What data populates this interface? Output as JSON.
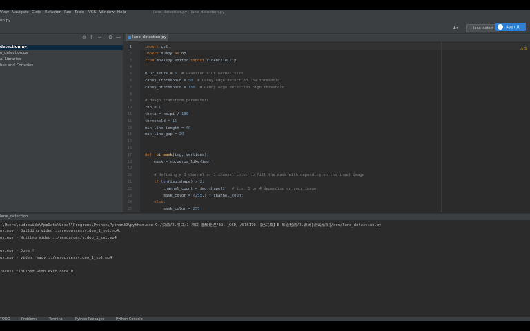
{
  "window": {
    "title": "lane_detection.py - lane_detection.py"
  },
  "menu": [
    "View",
    "Navigate",
    "Code",
    "Refactor",
    "Run",
    "Tools",
    "VCS",
    "Window",
    "Help"
  ],
  "breadcrumb": "on.py",
  "toolbar": {
    "run_config": "lane_detect",
    "ext_button": "实用工具"
  },
  "project": {
    "items": [
      "detection.py",
      "e_detection.py",
      "al Libraries",
      "hes and Consoles"
    ]
  },
  "editor": {
    "tab": "lane_detection.py",
    "warning": "⚠ 5",
    "lines": [
      {
        "n": "1",
        "t": [
          [
            "kw",
            "import "
          ],
          [
            "",
            "cv2"
          ]
        ]
      },
      {
        "n": "2",
        "t": [
          [
            "kw",
            "import "
          ],
          [
            "",
            "numpy "
          ],
          [
            "kw",
            "as "
          ],
          [
            "",
            "np"
          ]
        ]
      },
      {
        "n": "3",
        "t": [
          [
            "kw",
            "from "
          ],
          [
            "",
            "moviepy.editor "
          ],
          [
            "kw",
            "import "
          ],
          [
            "",
            "VideoFileClip"
          ]
        ]
      },
      {
        "n": "4",
        "t": []
      },
      {
        "n": "5",
        "t": [
          [
            "",
            "blur_ksize = "
          ],
          [
            "num",
            "5"
          ],
          [
            "cm",
            "  # Gaussian blur kernel size"
          ]
        ]
      },
      {
        "n": "6",
        "t": [
          [
            "",
            "canny_lthreshold = "
          ],
          [
            "num",
            "50"
          ],
          [
            "cm",
            "  # Canny edge detection low threshold"
          ]
        ]
      },
      {
        "n": "7",
        "t": [
          [
            "",
            "canny_hthreshold = "
          ],
          [
            "num",
            "150"
          ],
          [
            "cm",
            "  # Canny edge detection high threshold"
          ]
        ]
      },
      {
        "n": "8",
        "t": []
      },
      {
        "n": "9",
        "t": [
          [
            "cm",
            "# Hough transform parameters"
          ]
        ]
      },
      {
        "n": "10",
        "t": [
          [
            "",
            "rho = "
          ],
          [
            "num",
            "1"
          ]
        ]
      },
      {
        "n": "11",
        "t": [
          [
            "",
            "theta = np.pi / "
          ],
          [
            "num",
            "180"
          ]
        ]
      },
      {
        "n": "12",
        "t": [
          [
            "",
            "threshold = "
          ],
          [
            "num",
            "15"
          ]
        ]
      },
      {
        "n": "13",
        "t": [
          [
            "",
            "min_line_length = "
          ],
          [
            "num",
            "40"
          ]
        ]
      },
      {
        "n": "14",
        "t": [
          [
            "",
            "max_line_gap = "
          ],
          [
            "num",
            "20"
          ]
        ]
      },
      {
        "n": "15",
        "t": []
      },
      {
        "n": "16",
        "t": []
      },
      {
        "n": "17",
        "t": [
          [
            "kw",
            "def "
          ],
          [
            "fn",
            "roi_mask"
          ],
          [
            "",
            "(img, vertices):"
          ]
        ]
      },
      {
        "n": "18",
        "t": [
          [
            "",
            "    mask = np.zeros_like(img)"
          ]
        ]
      },
      {
        "n": "19",
        "t": []
      },
      {
        "n": "20",
        "t": [
          [
            "cm",
            "    # defining a 3 channel or 1 channel color to fill the mask with depending on the input image"
          ]
        ]
      },
      {
        "n": "21",
        "t": [
          [
            "kw",
            "    if "
          ],
          [
            "bi",
            "len"
          ],
          [
            "",
            "(img.shape) > "
          ],
          [
            "num",
            "2"
          ],
          [
            "",
            ":"
          ]
        ]
      },
      {
        "n": "22",
        "t": [
          [
            "",
            "        channel_count = img.shape["
          ],
          [
            "num",
            "2"
          ],
          [
            "",
            "]"
          ],
          [
            "cm",
            "  # i.e. 3 or 4 depending on your image"
          ]
        ]
      },
      {
        "n": "23",
        "t": [
          [
            "",
            "        mask_color = ("
          ],
          [
            "num",
            "255"
          ],
          [
            "",
            ",) * channel_count"
          ]
        ]
      },
      {
        "n": "24",
        "t": [
          [
            "kw",
            "    else"
          ],
          [
            "",
            ":"
          ]
        ]
      },
      {
        "n": "25",
        "t": [
          [
            "",
            "        mask_color = "
          ],
          [
            "num",
            "255"
          ]
        ]
      }
    ]
  },
  "run": {
    "tab": "lane_detection",
    "output": [
      ":\\Users\\sudoewide\\AppData\\Local\\Programs\\Python\\Python39\\python.exe G:/资源/2.项目/1.项目-图像处理/33.【CSD】/S1S170.【已完成】B-车道检测/2.源码[测试无误]/src/lane_detection.py",
      "oviepy - Building video ../resources/video_1_sol.mp4.",
      "oviepy - Writing video ../resources/video_1_sol.mp4",
      "",
      "oviepy - Done !",
      "oviepy - video ready ../resources/video_1_sol.mp4",
      "",
      "rocess finished with exit code 0"
    ]
  },
  "bottom_tabs": [
    "TODO",
    "Problems",
    "Terminal",
    "Python Packages",
    "Python Console"
  ]
}
